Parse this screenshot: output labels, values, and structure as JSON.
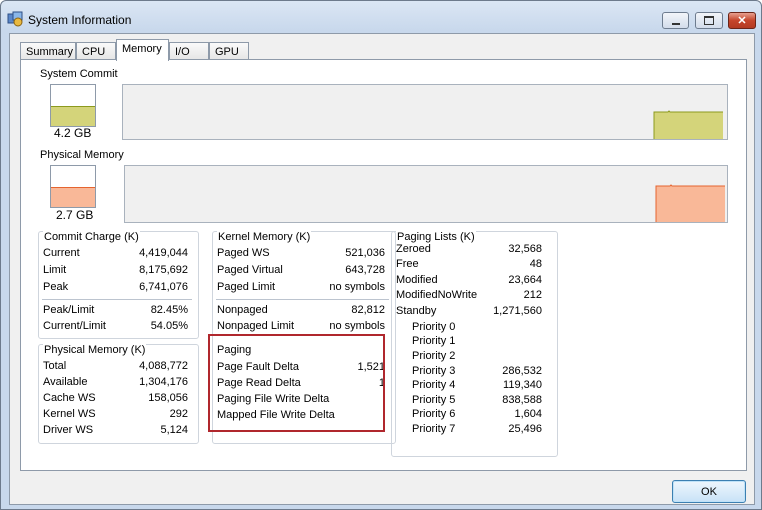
{
  "window": {
    "title": "System Information"
  },
  "tabs": [
    {
      "label": "Summary"
    },
    {
      "label": "CPU"
    },
    {
      "label": "Memory"
    },
    {
      "label": "I/O"
    },
    {
      "label": "GPU"
    }
  ],
  "system_commit": {
    "label": "System Commit",
    "value": "4.2 GB",
    "gauge_fill_fraction": 0.5,
    "color": "#d4d47a",
    "line_color": "#8c9a1e"
  },
  "physical_memory_graph": {
    "label": "Physical Memory",
    "value": "2.7 GB",
    "gauge_fill_fraction": 0.5,
    "color": "#f9b898",
    "line_color": "#e5642f"
  },
  "commit_charge": {
    "title": "Commit Charge (K)",
    "rows": [
      {
        "label": "Current",
        "value": "4,419,044"
      },
      {
        "label": "Limit",
        "value": "8,175,692"
      },
      {
        "label": "Peak",
        "value": "6,741,076"
      },
      {
        "label": "Peak/Limit",
        "value": "82.45%"
      },
      {
        "label": "Current/Limit",
        "value": "54.05%"
      }
    ]
  },
  "physical_memory": {
    "title": "Physical Memory (K)",
    "rows": [
      {
        "label": "Total",
        "value": "4,088,772"
      },
      {
        "label": "Available",
        "value": "1,304,176"
      },
      {
        "label": "Cache WS",
        "value": "158,056"
      },
      {
        "label": "Kernel WS",
        "value": "292"
      },
      {
        "label": "Driver WS",
        "value": "5,124"
      }
    ]
  },
  "kernel_memory": {
    "title": "Kernel Memory (K)",
    "rows": [
      {
        "label": "Paged WS",
        "value": "521,036"
      },
      {
        "label": "Paged Virtual",
        "value": "643,728"
      },
      {
        "label": "Paged Limit",
        "value": "no symbols"
      },
      {
        "label": "Nonpaged",
        "value": "82,812"
      },
      {
        "label": "Nonpaged Limit",
        "value": "no symbols"
      }
    ]
  },
  "paging": {
    "title": "Paging",
    "rows": [
      {
        "label": "Page Fault Delta",
        "value": "1,521"
      },
      {
        "label": "Page Read Delta",
        "value": "1"
      },
      {
        "label": "Paging File Write Delta",
        "value": ""
      },
      {
        "label": "Mapped File Write Delta",
        "value": ""
      }
    ]
  },
  "paging_lists": {
    "title": "Paging Lists (K)",
    "rows": [
      {
        "label": "Zeroed",
        "value": "32,568"
      },
      {
        "label": "Free",
        "value": "48"
      },
      {
        "label": "Modified",
        "value": "23,664"
      },
      {
        "label": "ModifiedNoWrite",
        "value": "212"
      },
      {
        "label": "Standby",
        "value": "1,271,560"
      }
    ],
    "priorities": [
      {
        "label": "Priority 0",
        "value": ""
      },
      {
        "label": "Priority 1",
        "value": ""
      },
      {
        "label": "Priority 2",
        "value": ""
      },
      {
        "label": "Priority 3",
        "value": "286,532"
      },
      {
        "label": "Priority 4",
        "value": "119,340"
      },
      {
        "label": "Priority 5",
        "value": "838,588"
      },
      {
        "label": "Priority 6",
        "value": "1,604"
      },
      {
        "label": "Priority 7",
        "value": "25,496"
      }
    ]
  },
  "ok_label": "OK"
}
